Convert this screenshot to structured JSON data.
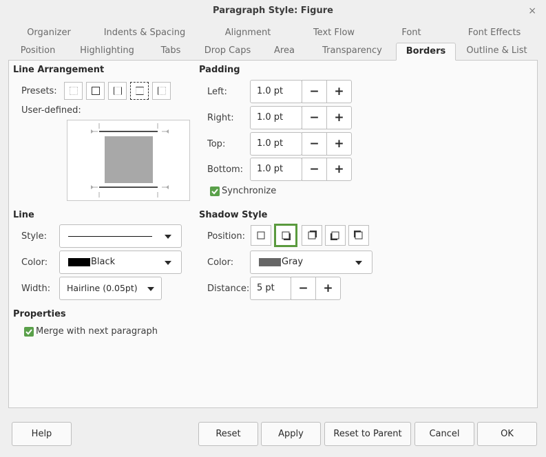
{
  "window": {
    "title": "Paragraph Style: Figure",
    "close_glyph": "×"
  },
  "tabs_row1": [
    "Organizer",
    "Indents & Spacing",
    "Alignment",
    "Text Flow",
    "Font",
    "Font Effects"
  ],
  "tabs_row2": [
    "Position",
    "Highlighting",
    "Tabs",
    "Drop Caps",
    "Area",
    "Transparency",
    "Borders",
    "Outline & List"
  ],
  "active_tab": "Borders",
  "line_arrangement": {
    "title": "Line Arrangement",
    "presets_label": "Presets:",
    "user_defined_label": "User-defined:"
  },
  "padding": {
    "title": "Padding",
    "left_label": "Left:",
    "left_value": "1.0 pt",
    "right_label": "Right:",
    "right_value": "1.0 pt",
    "top_label": "Top:",
    "top_value": "1.0 pt",
    "bottom_label": "Bottom:",
    "bottom_value": "1.0 pt",
    "synchronize_label": "Synchronize",
    "synchronize_checked": true
  },
  "line": {
    "title": "Line",
    "style_label": "Style:",
    "color_label": "Color:",
    "color_value": "Black",
    "color_swatch": "#000000",
    "width_label": "Width:",
    "width_value": "Hairline (0.05pt)"
  },
  "shadow_style": {
    "title": "Shadow Style",
    "position_label": "Position:",
    "color_label": "Color:",
    "color_value": "Gray",
    "color_swatch": "#666666",
    "distance_label": "Distance:",
    "distance_value": "5 pt"
  },
  "properties": {
    "title": "Properties",
    "merge_label": "Merge with next paragraph",
    "merge_checked": true
  },
  "stepper": {
    "minus": "−",
    "plus": "+"
  },
  "buttons": {
    "help": "Help",
    "reset": "Reset",
    "apply": "Apply",
    "reset_to_parent": "Reset to Parent",
    "cancel": "Cancel",
    "ok": "OK"
  },
  "colors": {
    "accent": "#5a9a3e",
    "checkbox": "#5aa04a"
  }
}
